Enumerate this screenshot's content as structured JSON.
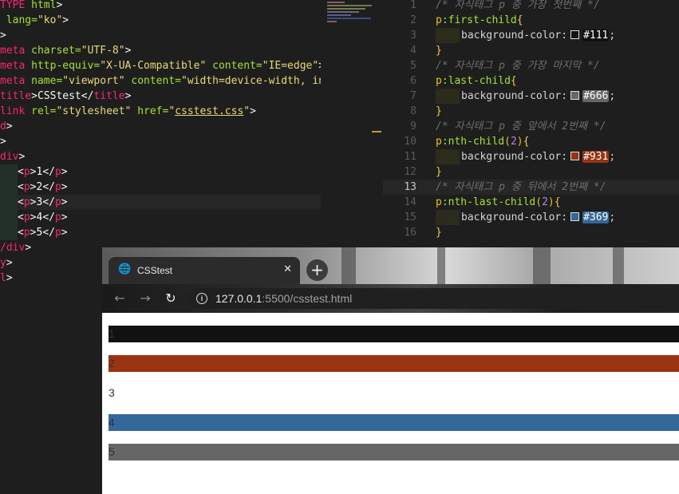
{
  "html_editor": {
    "lines": [
      {
        "t": "doctype",
        "parts": [
          [
            "TYPE ",
            "t-doc"
          ],
          [
            "html",
            "t-attr"
          ],
          [
            ">",
            "t-punc"
          ]
        ]
      },
      {
        "t": "html",
        "parts": [
          [
            " lang=",
            "t-attr"
          ],
          [
            "\"ko\"",
            "t-str"
          ],
          [
            ">",
            "t-punc"
          ]
        ]
      },
      {
        "t": "gt",
        "parts": [
          [
            ">",
            "t-punc"
          ]
        ]
      },
      {
        "t": "meta1",
        "parts": [
          [
            "meta ",
            "t-tag"
          ],
          [
            "charset=",
            "t-attr"
          ],
          [
            "\"UTF-8\"",
            "t-str"
          ],
          [
            ">",
            "t-punc"
          ]
        ]
      },
      {
        "t": "meta2",
        "parts": [
          [
            "meta ",
            "t-tag"
          ],
          [
            "http-equiv=",
            "t-attr"
          ],
          [
            "\"X-UA-Compatible\" ",
            "t-str"
          ],
          [
            "content=",
            "t-attr"
          ],
          [
            "\"IE=edge\"",
            "t-str"
          ],
          [
            ">",
            "t-punc"
          ]
        ]
      },
      {
        "t": "meta3",
        "parts": [
          [
            "meta ",
            "t-tag"
          ],
          [
            "name=",
            "t-attr"
          ],
          [
            "\"viewport\" ",
            "t-str"
          ],
          [
            "content=",
            "t-attr"
          ],
          [
            "\"width=device-width, in",
            "t-str"
          ]
        ]
      },
      {
        "t": "title",
        "parts": [
          [
            "title",
            "t-tag"
          ],
          [
            ">",
            "t-punc"
          ],
          [
            "CSStest",
            "t-txt"
          ],
          [
            "</",
            "t-punc"
          ],
          [
            "title",
            "t-tag"
          ],
          [
            ">",
            "t-punc"
          ]
        ]
      },
      {
        "t": "link",
        "parts": [
          [
            "link ",
            "t-tag"
          ],
          [
            "rel=",
            "t-attr"
          ],
          [
            "\"stylesheet\" ",
            "t-str"
          ],
          [
            "href=",
            "t-attr"
          ],
          [
            "\"",
            "t-str"
          ],
          [
            "csstest.css",
            "t-str under"
          ],
          [
            "\"",
            "t-str"
          ],
          [
            ">",
            "t-punc"
          ]
        ]
      },
      {
        "t": "headclose",
        "parts": [
          [
            "d",
            "t-tag"
          ],
          [
            ">",
            "t-punc"
          ]
        ]
      },
      {
        "t": "gt2",
        "parts": [
          [
            ">",
            "t-punc"
          ]
        ]
      },
      {
        "t": "div",
        "parts": [
          [
            "div",
            "t-tag"
          ],
          [
            ">",
            "t-punc"
          ]
        ]
      },
      {
        "t": "p1",
        "guide": true,
        "parts": [
          [
            "<",
            "t-punc"
          ],
          [
            "p",
            "t-tag"
          ],
          [
            ">",
            "t-punc"
          ],
          [
            "1",
            "t-txt"
          ],
          [
            "</",
            "t-punc"
          ],
          [
            "p",
            "t-tag"
          ],
          [
            ">",
            "t-punc"
          ]
        ]
      },
      {
        "t": "p2",
        "guide": true,
        "parts": [
          [
            "<",
            "t-punc"
          ],
          [
            "p",
            "t-tag"
          ],
          [
            ">",
            "t-punc"
          ],
          [
            "2",
            "t-txt"
          ],
          [
            "</",
            "t-punc"
          ],
          [
            "p",
            "t-tag"
          ],
          [
            ">",
            "t-punc"
          ]
        ]
      },
      {
        "t": "p3",
        "guide": true,
        "active": true,
        "parts": [
          [
            "<",
            "t-punc"
          ],
          [
            "p",
            "t-tag"
          ],
          [
            ">",
            "t-punc"
          ],
          [
            "3",
            "t-txt"
          ],
          [
            "</",
            "t-punc"
          ],
          [
            "p",
            "t-tag"
          ],
          [
            ">",
            "t-punc"
          ]
        ]
      },
      {
        "t": "p4",
        "guide": true,
        "parts": [
          [
            "<",
            "t-punc"
          ],
          [
            "p",
            "t-tag"
          ],
          [
            ">",
            "t-punc"
          ],
          [
            "4",
            "t-txt"
          ],
          [
            "</",
            "t-punc"
          ],
          [
            "p",
            "t-tag"
          ],
          [
            ">",
            "t-punc"
          ]
        ]
      },
      {
        "t": "p5",
        "guide": true,
        "parts": [
          [
            "<",
            "t-punc"
          ],
          [
            "p",
            "t-tag"
          ],
          [
            ">",
            "t-punc"
          ],
          [
            "5",
            "t-txt"
          ],
          [
            "</",
            "t-punc"
          ],
          [
            "p",
            "t-tag"
          ],
          [
            ">",
            "t-punc"
          ]
        ]
      },
      {
        "t": "divclose",
        "parts": [
          [
            "/div",
            "t-tag"
          ],
          [
            ">",
            "t-punc"
          ]
        ]
      },
      {
        "t": "bodyclose",
        "parts": [
          [
            "y",
            "t-tag"
          ],
          [
            ">",
            "t-punc"
          ]
        ]
      },
      {
        "t": "htmlclose",
        "parts": [
          [
            "l",
            "t-tag"
          ],
          [
            ">",
            "t-punc"
          ]
        ]
      }
    ]
  },
  "css_editor": {
    "lines": [
      {
        "n": "1",
        "kind": "comment",
        "text": "/* 자식태그 p 중 가장 첫번째 */"
      },
      {
        "n": "2",
        "kind": "selector",
        "sel": "p",
        "pseudo": ":first-child",
        "brace": "{"
      },
      {
        "n": "3",
        "kind": "decl",
        "prop": "background-color:",
        "hex": "#111",
        "swatch": "#111111",
        "hexbg": "#111111",
        "end": ";"
      },
      {
        "n": "4",
        "kind": "close",
        "text": "}"
      },
      {
        "n": "5",
        "kind": "comment",
        "text": "/* 자식태그 p 중 가장 마지막 */"
      },
      {
        "n": "6",
        "kind": "selector",
        "sel": "p",
        "pseudo": ":last-child",
        "brace": "{"
      },
      {
        "n": "7",
        "kind": "decl",
        "prop": "background-color:",
        "hex": "#666",
        "swatch": "#666666",
        "hexbg": "#666666",
        "end": ";"
      },
      {
        "n": "8",
        "kind": "close",
        "text": "}"
      },
      {
        "n": "9",
        "kind": "comment",
        "text": "/* 자식태그 p 중 앞에서 2번째 */"
      },
      {
        "n": "10",
        "kind": "selector",
        "sel": "p",
        "pseudo": ":nth-child",
        "arg": "2",
        "brace": "{"
      },
      {
        "n": "11",
        "kind": "decl",
        "prop": "background-color:",
        "hex": "#931",
        "swatch": "#993311",
        "hexbg": "#993311",
        "end": ";"
      },
      {
        "n": "12",
        "kind": "close",
        "text": "}"
      },
      {
        "n": "13",
        "kind": "comment",
        "active": true,
        "text": "/* 자식태그 p 중 뒤에서 2번째 */"
      },
      {
        "n": "14",
        "kind": "selector",
        "sel": "p",
        "pseudo": ":nth-last-child",
        "arg": "2",
        "brace": "{"
      },
      {
        "n": "15",
        "kind": "decl",
        "prop": "background-color:",
        "hex": "#369",
        "swatch": "#336699",
        "hexbg": "#336699",
        "end": ";"
      },
      {
        "n": "16",
        "kind": "close",
        "text": "}"
      }
    ]
  },
  "browser": {
    "tab_title": "CSStest",
    "tab_icon": "globe-icon",
    "close_glyph": "✕",
    "new_tab_glyph": "+",
    "back_glyph": "←",
    "forward_glyph": "→",
    "reload_glyph": "↻",
    "info_glyph": "i",
    "url_host": "127.0.0.1",
    "url_rest": ":5500/csstest.html"
  },
  "page": {
    "paragraphs": [
      {
        "text": "1",
        "bg": "#111111"
      },
      {
        "text": "2",
        "bg": "#993311"
      },
      {
        "text": "3",
        "bg": "#ffffff"
      },
      {
        "text": "4",
        "bg": "#336699"
      },
      {
        "text": "5",
        "bg": "#666666"
      }
    ]
  }
}
